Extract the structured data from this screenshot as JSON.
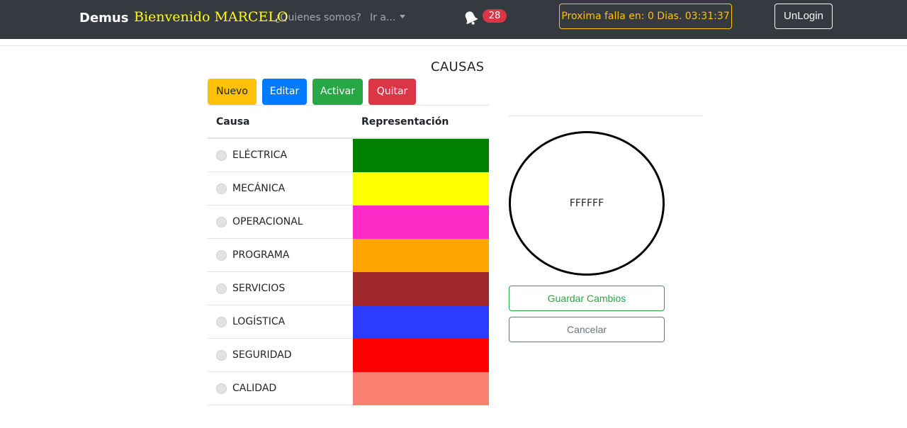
{
  "navbar": {
    "brand": "Demus",
    "welcome": "Bienvenido MARCELO",
    "about_link": "¿Quienes somos?",
    "goto_link": "Ir a...",
    "notification_count": "28",
    "countdown": "Proxima falla en: 0 Dias. 03:31:37",
    "logout_label": "UnLogin",
    "icons": {
      "notifications": "bell-icon",
      "dropdown": "caret-down-icon"
    }
  },
  "page": {
    "title": "CAUSAS"
  },
  "actions": {
    "new_label": "Nuevo",
    "edit_label": "Editar",
    "activate_label": "Activar",
    "remove_label": "Quitar"
  },
  "table": {
    "headers": {
      "cause": "Causa",
      "representation": "Representación"
    },
    "rows": [
      {
        "name": "ELÉCTRICA",
        "color": "#008000"
      },
      {
        "name": "MECÁNICA",
        "color": "#FFFF00"
      },
      {
        "name": "OPERACIONAL",
        "color": "#FF2BC8"
      },
      {
        "name": "PROGRAMA",
        "color": "#FFA500"
      },
      {
        "name": "SERVICIOS",
        "color": "#A0282A"
      },
      {
        "name": "LOGÍSTICA",
        "color": "#2B3CFF"
      },
      {
        "name": "SEGURIDAD",
        "color": "#FF0000"
      },
      {
        "name": "CALIDAD",
        "color": "#FA8072"
      }
    ]
  },
  "preview": {
    "color_code": "FFFFFF"
  },
  "form": {
    "save_label": "Guardar Cambios",
    "cancel_label": "Cancelar"
  },
  "colors": {
    "navbar_bg": "#343a40",
    "welcome": "#ffff00",
    "warning": "#ffc107",
    "primary": "#007bff",
    "success": "#28a745",
    "danger": "#dc3545",
    "secondary": "#6c757d"
  }
}
